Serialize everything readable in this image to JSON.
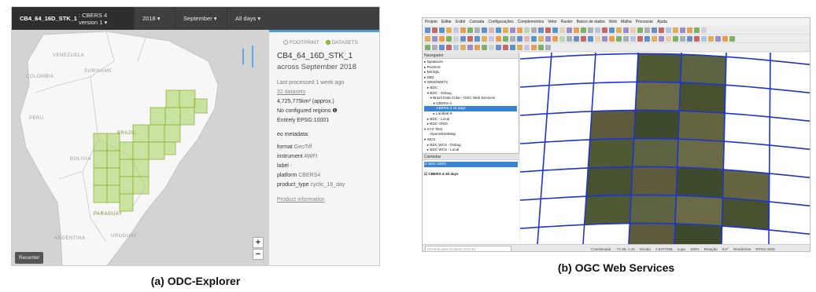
{
  "panel_a": {
    "caption": "(a) ODC-Explorer",
    "topbar": {
      "product_code": "CB4_64_16D_STK_1",
      "product_desc": ": CBERS 4 version 1 ▾",
      "year": "2018 ▾",
      "month": "September ▾",
      "days": "All days ▾"
    },
    "map_labels": {
      "venezuela": "VENEZUELA",
      "suriname": "SURINAME",
      "colombia": "COLOMBIA",
      "peru": "PERU",
      "brazil": "BRAZIL",
      "bolivia": "BOLIVIA",
      "paraguay": "PARAGUAY",
      "uruguay": "URUGUAY",
      "argentina": "ARGENTINA",
      "zoom_in": "+",
      "zoom_out": "−",
      "recenter": "Recenter"
    },
    "sidebar": {
      "footprint": "FOOTPRINT",
      "datasets": "DATASETS",
      "product": "CB4_64_16D_STK_1",
      "period": "across September 2018",
      "last_processed": "Last processed 1 week ago",
      "datasets_count": "32 datasets",
      "area": "4,725,775km² (approx.)",
      "regions": "No configured regions ❶",
      "epsg": "Entirely EPSG:10001",
      "metadata_heading": "eo metadata:",
      "format_label": "format",
      "format_value": "GeoTiff",
      "instrument_label": "instrument",
      "instrument_value": "AWFI",
      "label_label": "label",
      "label_value": "-",
      "platform_label": "platform",
      "platform_value": "CBERS4",
      "product_type_label": "product_type",
      "product_type_value": "cyclic_16_day",
      "product_info": "Product information"
    }
  },
  "panel_b": {
    "caption": "(b) OGC Web Services",
    "menubar": [
      "Projeto",
      "Editar",
      "Exibir",
      "Camada",
      "Configurações",
      "Complementos",
      "Vetor",
      "Raster",
      "Banco de dados",
      "Web",
      "Malha",
      "Processar",
      "Ajuda"
    ],
    "navigator": {
      "title": "Navegador",
      "items": [
        "▸ SpatiaLite",
        "▸ PostGIS",
        "▸ MSSQL",
        "▸ DB2",
        "▾ WMS/WMTS",
        "   ▸ BDC",
        "   ▾ BDC - Debug",
        "      ▾ Brazil Data Cube - OGC Web Services",
        "         ▾ CBERS-4",
        "            CBERS-4 16 days",
        "         ▸ Landsat-8",
        "   ▸ BDC - Local",
        "   ▸ BDC GRID",
        "▾ XYZ Tiles",
        "      OpenStreetMap",
        "▾ WCS",
        "   ▸ BDC WCS - Debug",
        "   ▸ BDC WCS - Local"
      ],
      "selected_index": 9
    },
    "layers": {
      "title": "Camadas",
      "items": [
        "BDC GRID",
        "CBERS-4 16 days"
      ],
      "selected_index": 0
    },
    "status": {
      "search_placeholder": "Escreva para localizar (Ctrl+K)",
      "coordinate_label": "Coordenada",
      "coordinate_value": "-71.86,-1.41",
      "scale_label": "Escala",
      "scale_value": "1:5477266",
      "zoom_label": "Lupa",
      "zoom_value": "100%",
      "rotation_label": "Rotação",
      "rotation_value": "0,0°",
      "render_label": "Renderizar",
      "crs": "EPSG:4326"
    }
  }
}
